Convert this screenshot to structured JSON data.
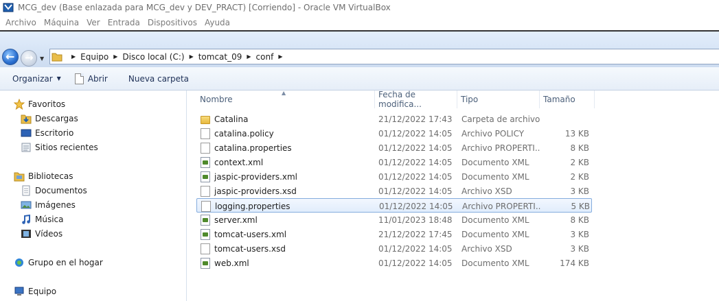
{
  "window": {
    "title": "MCG_dev (Base enlazada para MCG_dev y DEV_PRACT) [Corriendo] - Oracle VM VirtualBox"
  },
  "menu": [
    "Archivo",
    "Máquina",
    "Ver",
    "Entrada",
    "Dispositivos",
    "Ayuda"
  ],
  "address": {
    "crumbs": [
      "Equipo",
      "Disco local (C:)",
      "tomcat_09",
      "conf"
    ]
  },
  "toolbar": {
    "organize_label": "Organizar",
    "open_label": "Abrir",
    "new_folder_label": "Nueva carpeta"
  },
  "nav": {
    "favorites": "Favoritos",
    "downloads": "Descargas",
    "desktop": "Escritorio",
    "recent": "Sitios recientes",
    "libraries": "Bibliotecas",
    "documents": "Documentos",
    "images": "Imágenes",
    "music": "Música",
    "videos": "Vídeos",
    "homegroup": "Grupo en el hogar",
    "computer": "Equipo"
  },
  "columns": {
    "name": "Nombre",
    "date": "Fecha de modifica...",
    "type": "Tipo",
    "size": "Tamaño"
  },
  "files": [
    {
      "name": "Catalina",
      "date": "21/12/2022 17:43",
      "type": "Carpeta de archivos",
      "size": "",
      "icon": "folder-icon"
    },
    {
      "name": "catalina.policy",
      "date": "01/12/2022 14:05",
      "type": "Archivo POLICY",
      "size": "13 KB",
      "icon": "file-icon"
    },
    {
      "name": "catalina.properties",
      "date": "01/12/2022 14:05",
      "type": "Archivo PROPERTI...",
      "size": "8 KB",
      "icon": "file-icon"
    },
    {
      "name": "context.xml",
      "date": "01/12/2022 14:05",
      "type": "Documento XML",
      "size": "2 KB",
      "icon": "xml-file-icon"
    },
    {
      "name": "jaspic-providers.xml",
      "date": "01/12/2022 14:05",
      "type": "Documento XML",
      "size": "2 KB",
      "icon": "xml-file-icon"
    },
    {
      "name": "jaspic-providers.xsd",
      "date": "01/12/2022 14:05",
      "type": "Archivo XSD",
      "size": "3 KB",
      "icon": "file-icon"
    },
    {
      "name": "logging.properties",
      "date": "01/12/2022 14:05",
      "type": "Archivo PROPERTI...",
      "size": "5 KB",
      "icon": "file-icon"
    },
    {
      "name": "server.xml",
      "date": "11/01/2023 18:48",
      "type": "Documento XML",
      "size": "8 KB",
      "icon": "xml-file-icon"
    },
    {
      "name": "tomcat-users.xml",
      "date": "21/12/2022 17:45",
      "type": "Documento XML",
      "size": "3 KB",
      "icon": "xml-file-icon"
    },
    {
      "name": "tomcat-users.xsd",
      "date": "01/12/2022 14:05",
      "type": "Archivo XSD",
      "size": "3 KB",
      "icon": "file-icon"
    },
    {
      "name": "web.xml",
      "date": "01/12/2022 14:05",
      "type": "Documento XML",
      "size": "174 KB",
      "icon": "xml-file-icon"
    }
  ],
  "selected_file": "logging.properties",
  "colors": {
    "selection_border": "#84acdd",
    "selection_fill": "#e1edfc",
    "address_gradient": "#d5e3f5"
  }
}
